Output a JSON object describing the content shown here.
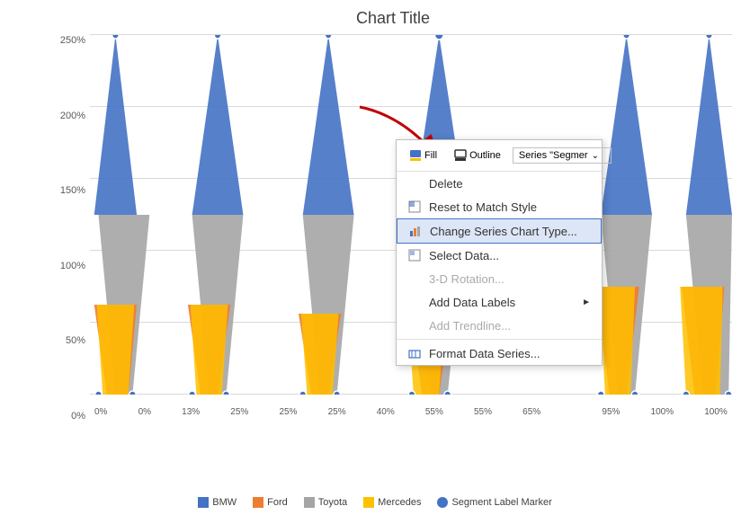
{
  "chart": {
    "title": "Chart Title",
    "yAxis": {
      "labels": [
        "0%",
        "50%",
        "100%",
        "150%",
        "200%",
        "250%"
      ]
    },
    "xLabels": [
      "0%",
      "0%",
      "13%",
      "25%",
      "25%",
      "25%",
      "40%",
      "55%",
      "55%",
      "65%",
      "",
      "",
      "95%",
      "100%",
      "100%"
    ]
  },
  "legend": {
    "items": [
      {
        "label": "BMW",
        "color": "#4472C4"
      },
      {
        "label": "Ford",
        "color": "#ED7D31"
      },
      {
        "label": "Toyota",
        "color": "#A5A5A5"
      },
      {
        "label": "Mercedes",
        "color": "#FFC000"
      },
      {
        "label": "Segment Label Marker",
        "color": "#4472C4"
      }
    ]
  },
  "contextMenu": {
    "toolbar": {
      "fillLabel": "Fill",
      "outlineLabel": "Outline",
      "dropdownText": "Series \"Segmer"
    },
    "items": [
      {
        "id": "delete",
        "label": "Delete",
        "icon": "delete",
        "disabled": false,
        "hasSubmenu": false
      },
      {
        "id": "reset-style",
        "label": "Reset to Match Style",
        "icon": "reset",
        "disabled": false,
        "hasSubmenu": false
      },
      {
        "id": "change-chart-type",
        "label": "Change Series Chart Type...",
        "icon": "chart",
        "disabled": false,
        "highlighted": true,
        "hasSubmenu": false
      },
      {
        "id": "select-data",
        "label": "Select Data...",
        "icon": "data",
        "disabled": false,
        "hasSubmenu": false
      },
      {
        "id": "3d-rotation",
        "label": "3-D Rotation...",
        "icon": "rotation",
        "disabled": true,
        "hasSubmenu": false
      },
      {
        "id": "add-data-labels",
        "label": "Add Data Labels",
        "icon": "labels",
        "disabled": false,
        "hasSubmenu": true
      },
      {
        "id": "add-trendline",
        "label": "Add Trendline...",
        "icon": "trendline",
        "disabled": true,
        "hasSubmenu": false
      },
      {
        "id": "format-data-series",
        "label": "Format Data Series...",
        "icon": "format",
        "disabled": false,
        "hasSubmenu": false
      }
    ]
  }
}
